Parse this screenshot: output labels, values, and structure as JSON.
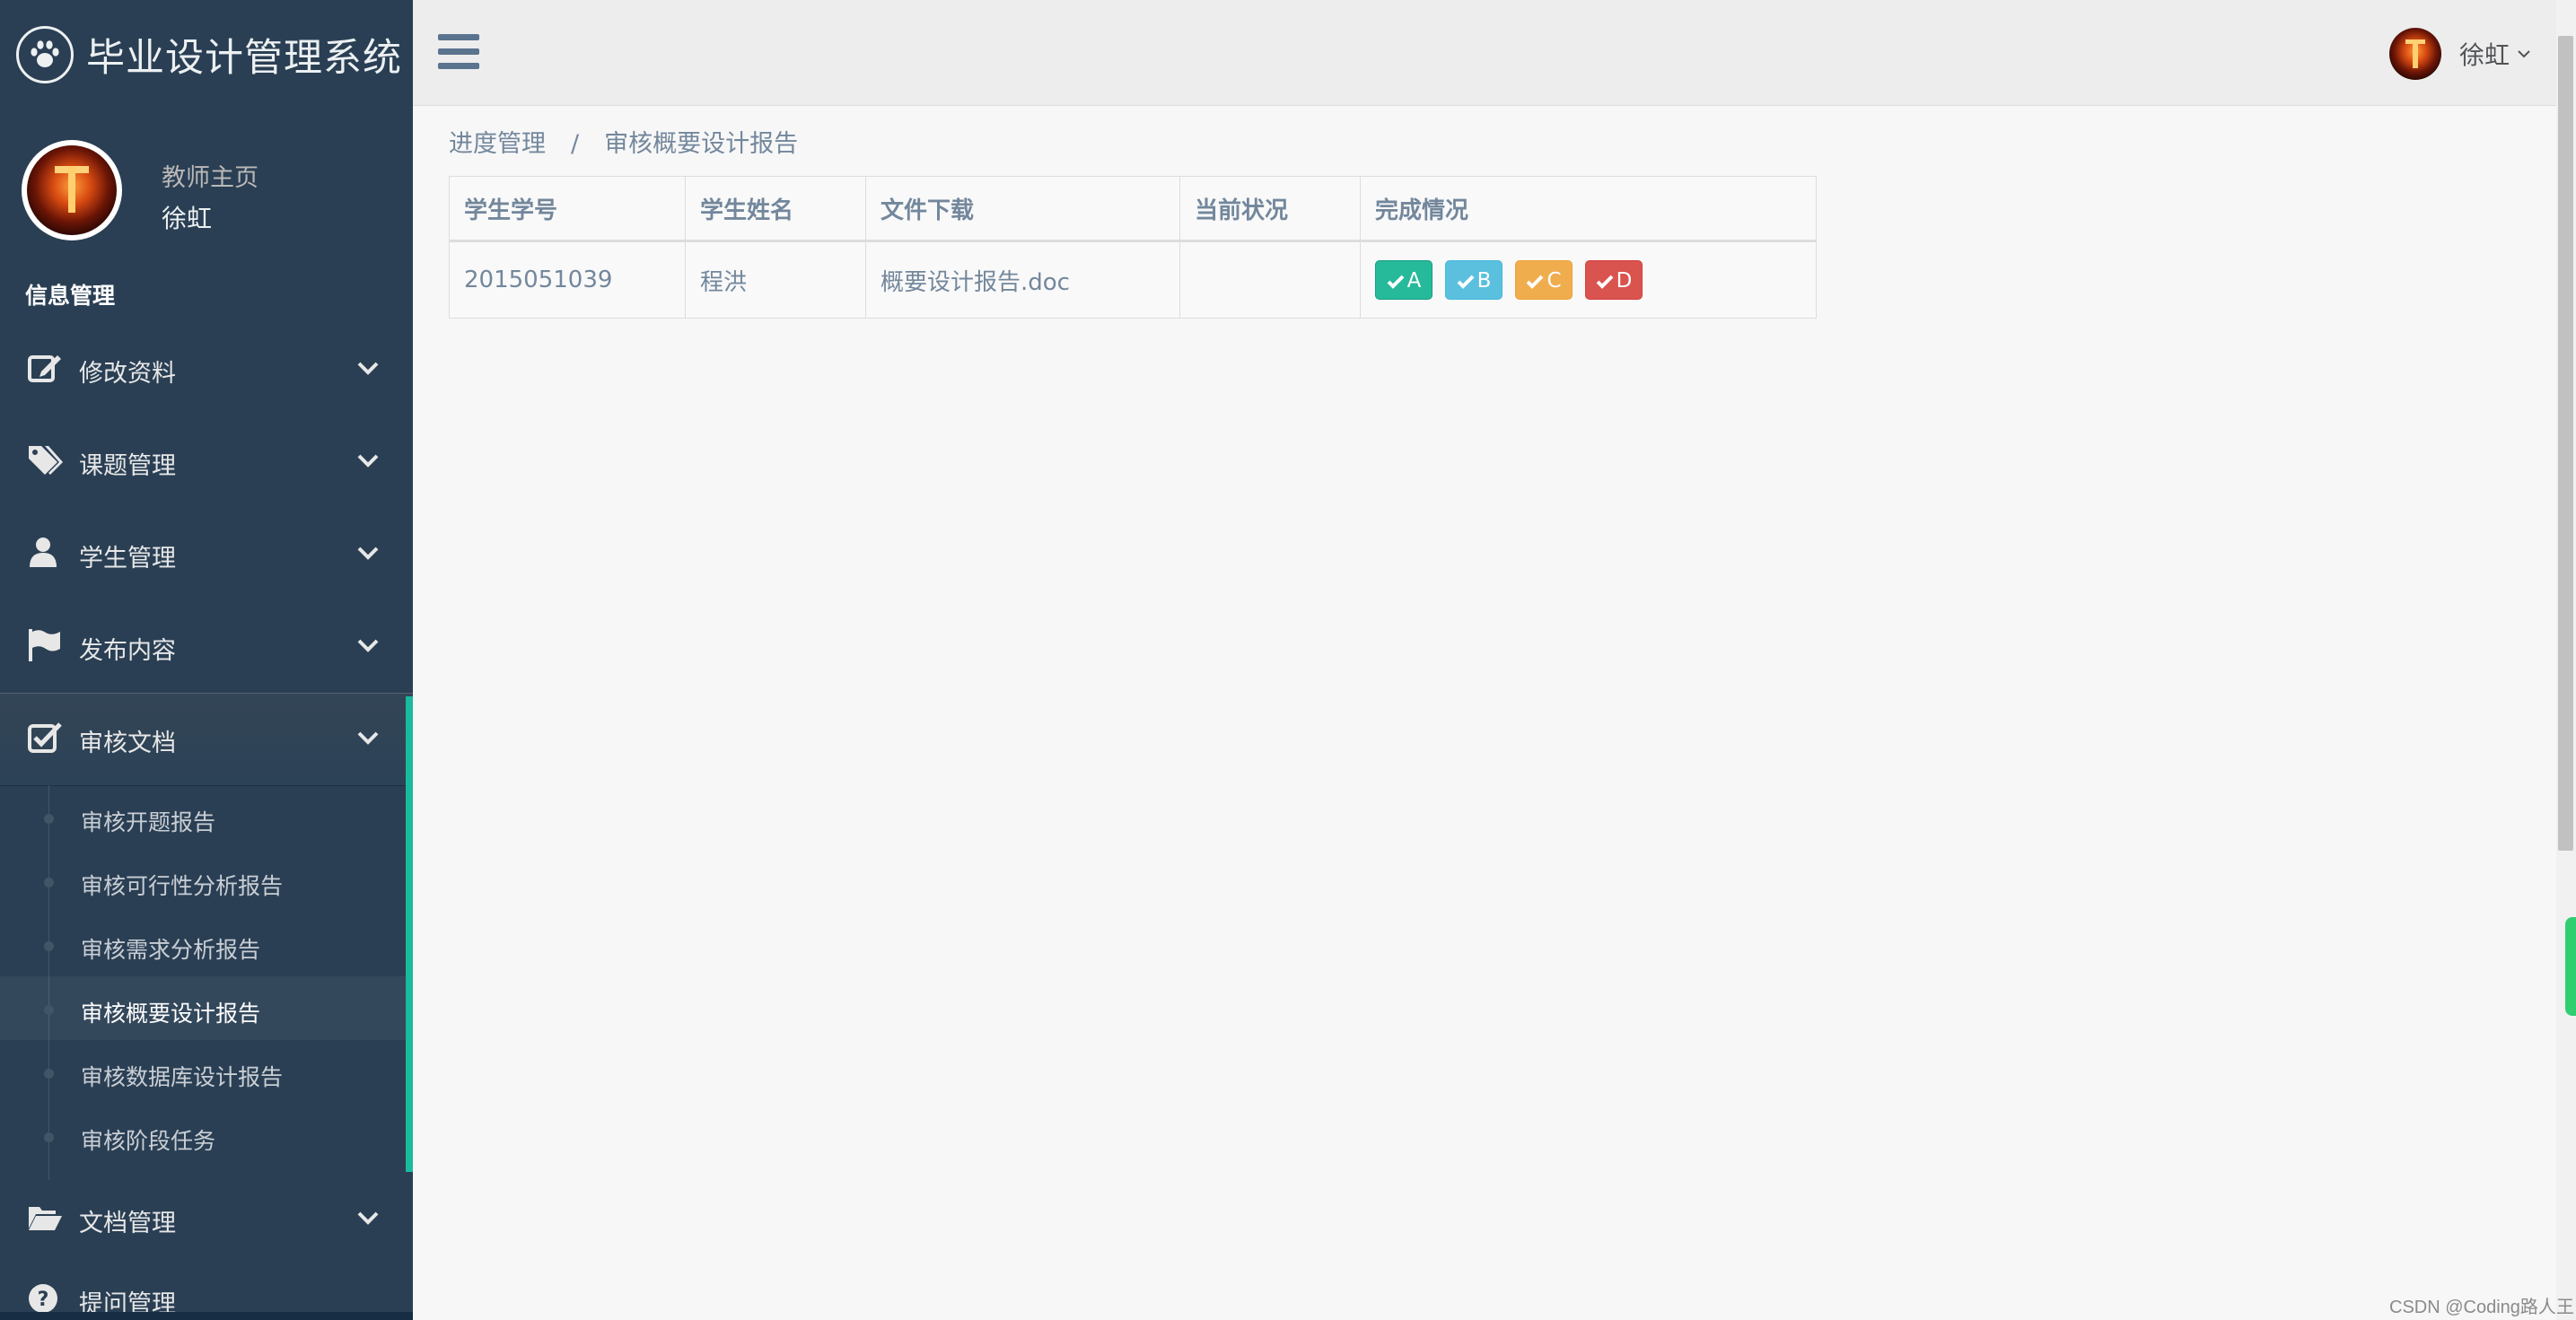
{
  "app": {
    "title": "毕业设计管理系统"
  },
  "profile": {
    "welcome": "教师主页",
    "name": "徐虹"
  },
  "sidebar": {
    "section_title": "信息管理",
    "menu": [
      {
        "label": "修改资料",
        "icon": "edit-icon"
      },
      {
        "label": "课题管理",
        "icon": "tags-icon"
      },
      {
        "label": "学生管理",
        "icon": "user-icon"
      },
      {
        "label": "发布内容",
        "icon": "flag-icon"
      },
      {
        "label": "审核文档",
        "icon": "check-square-icon",
        "active": true
      }
    ],
    "submenu": [
      "审核开题报告",
      "审核可行性分析报告",
      "审核需求分析报告",
      "审核概要设计报告",
      "审核数据库设计报告",
      "审核阶段任务"
    ],
    "submenu_current": "审核概要设计报告",
    "menu_after": [
      {
        "label": "文档管理",
        "icon": "folder-open-icon"
      },
      {
        "label": "提问管理",
        "icon": "question-icon"
      }
    ]
  },
  "topnav": {
    "user_name": "徐虹"
  },
  "breadcrumb": {
    "parent": "进度管理",
    "separator": "/",
    "current": "审核概要设计报告"
  },
  "table": {
    "headers": [
      "学生学号",
      "学生姓名",
      "文件下载",
      "当前状况",
      "完成情况"
    ],
    "rows": [
      {
        "student_id": "2015051039",
        "student_name": "程洪",
        "file": "概要设计报告.doc",
        "status": ""
      }
    ],
    "grade_buttons": [
      {
        "label": "A",
        "color": "#26b99a"
      },
      {
        "label": "B",
        "color": "#5bc0de"
      },
      {
        "label": "C",
        "color": "#f0ad4e"
      },
      {
        "label": "D",
        "color": "#d9534f"
      }
    ]
  },
  "watermark": "CSDN @Coding路人王",
  "colors": {
    "sidebar_bg": "#2a3f54",
    "accent": "#1abb9c",
    "page_bg": "#f7f7f7"
  }
}
